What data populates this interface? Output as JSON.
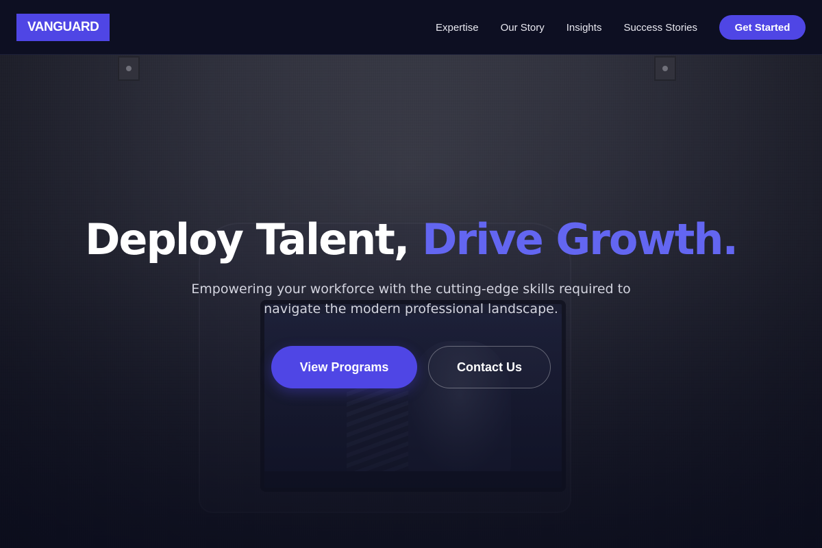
{
  "brand": {
    "logo_text": "VANGUARD",
    "accent_color": "#4f46e5",
    "headline_accent_color": "#6366f1",
    "nav_background": "#0d0f22"
  },
  "nav": {
    "links": [
      {
        "label": "Expertise"
      },
      {
        "label": "Our Story"
      },
      {
        "label": "Insights"
      },
      {
        "label": "Success Stories"
      }
    ],
    "cta_label": "Get Started"
  },
  "hero": {
    "headline_part1": "Deploy Talent,",
    "headline_part2": "Drive Growth.",
    "subheadline": "Empowering your workforce with the cutting-edge skills required to navigate the modern professional landscape.",
    "primary_button": "View Programs",
    "secondary_button": "Contact Us"
  }
}
